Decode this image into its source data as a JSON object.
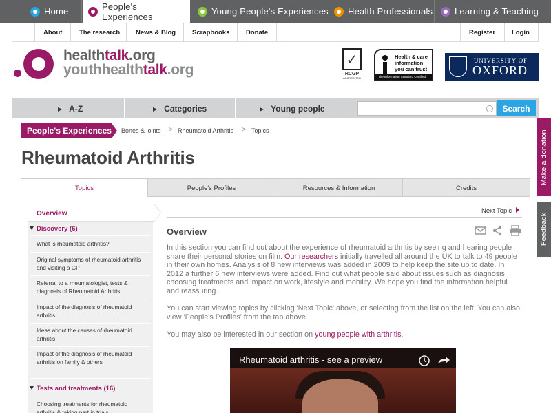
{
  "top_tabs": [
    {
      "label": "Home",
      "color": "#2ba5e3"
    },
    {
      "label": "People's Experiences",
      "color": "#9b1a66"
    },
    {
      "label": "Young People's Experiences",
      "color": "#8cc63f"
    },
    {
      "label": "Health Professionals",
      "color": "#f39200"
    },
    {
      "label": "Learning & Teaching",
      "color": "#9c6bbd"
    }
  ],
  "secondary_nav": {
    "left": [
      "About",
      "The research",
      "News & Blog",
      "Scrapbooks",
      "Donate"
    ],
    "right": [
      "Register",
      "Login"
    ]
  },
  "logo": {
    "line1_a": "health",
    "line1_b": "talk",
    "line1_c": ".org",
    "line2_a": "youthhealth",
    "line2_b": "talk",
    "line2_c": ".org"
  },
  "badges": {
    "rcgp_label": "RCGP",
    "rcgp_sub": "ACCREDITED",
    "info_standard": "Health & care information you can trust",
    "info_standard_foot": "The Information Standard   Certified Member",
    "oxford_l1": "UNIVERSITY OF",
    "oxford_l2": "OXFORD"
  },
  "category_bar": {
    "items": [
      "A-Z",
      "Categories",
      "Young people"
    ],
    "search_placeholder": "",
    "search_button": "Search"
  },
  "breadcrumb": {
    "section": "People's Experiences",
    "items": [
      "Bones & joints",
      "Rheumatoid Arthritis",
      "Topics"
    ]
  },
  "page_title": "Rheumatoid Arthritis",
  "side_tabs": {
    "donate": "Make a donation",
    "feedback": "Feedback"
  },
  "content_tabs": [
    "Topics",
    "People's Profiles",
    "Resources & Information",
    "Credits"
  ],
  "sidebar": {
    "overview": "Overview",
    "sections": [
      {
        "title": "Discovery (6)",
        "items": [
          "What is rheumatoid arthritis?",
          "Original symptoms of rheumatoid arthritis and visiting a GP",
          "Referral to a rheumatologist, tests & diagnosis of Rheumatoid Arthritis",
          "Impact of the diagnosis of rheumatoid arthritis",
          "Ideas about the causes of rheumatoid arthritis",
          "Impact of the diagnosis of rheumatoid arthritis on family & others"
        ]
      },
      {
        "title": "Tests and treatments (16)",
        "items": [
          "Choosing treatments for rheumatoid arthritis & taking part in trials"
        ]
      }
    ]
  },
  "main": {
    "next_topic": "Next Topic",
    "heading": "Overview",
    "p1_a": "In this section you can find out about the experience of rheumatoid arthritis by seeing and hearing people share their personal stories on film. ",
    "p1_link": "Our researchers",
    "p1_b": " initially travelled all around the UK to talk to 49 people in their own homes. Analysis of 8 new interviews was added in 2009 to help keep the site up to date. In 2012 a further 6 new interviews were added. Find out what people said about issues such as diagnosis, choosing treatments and impact on work, lifestyle and mobility. We hope you find the information helpful and reassuring.",
    "p2": "You can start viewing topics by clicking 'Next Topic' above, or selecting from the list on the left. You can also view 'People's Profiles' from the tab above.",
    "p3_a": "You may also be interested in our section on ",
    "p3_link": "young people with arthritis",
    "p3_b": ".",
    "video_title": "Rheumatoid arthritis - see a preview"
  },
  "icons": [
    "email-icon",
    "share-icon",
    "print-icon",
    "clock-icon",
    "share-arrow-icon",
    "search-icon"
  ],
  "colors": {
    "brand": "#9b1a66",
    "accent": "#2ba5e3",
    "nav_bg": "#5f6163"
  }
}
